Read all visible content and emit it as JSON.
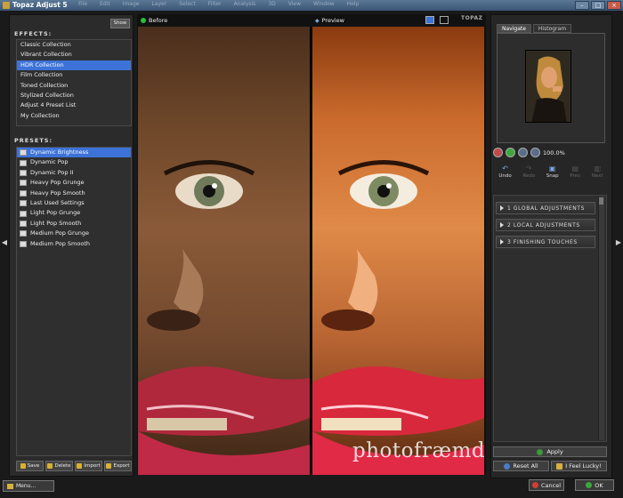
{
  "window": {
    "title": "Topaz Adjust 5",
    "menus": [
      "File",
      "Edit",
      "Image",
      "Layer",
      "Select",
      "Filter",
      "Analysis",
      "3D",
      "View",
      "Window",
      "Help"
    ]
  },
  "left": {
    "show_label": "Show",
    "effects_title": "EFFECTS:",
    "effects": [
      {
        "label": "Classic Collection",
        "selected": false
      },
      {
        "label": "Vibrant Collection",
        "selected": false
      },
      {
        "label": "HDR Collection",
        "selected": true
      },
      {
        "label": "Film Collection",
        "selected": false
      },
      {
        "label": "Toned Collection",
        "selected": false
      },
      {
        "label": "Stylized Collection",
        "selected": false
      },
      {
        "label": "Adjust 4 Preset List",
        "selected": false
      },
      {
        "label": "My Collection",
        "selected": false
      }
    ],
    "presets_title": "PRESETS:",
    "presets": [
      {
        "label": "Dynamic Brightness",
        "selected": true
      },
      {
        "label": "Dynamic Pop",
        "selected": false
      },
      {
        "label": "Dynamic Pop II",
        "selected": false
      },
      {
        "label": "Heavy Pop Grunge",
        "selected": false
      },
      {
        "label": "Heavy Pop Smooth",
        "selected": false
      },
      {
        "label": "Last Used Settings",
        "selected": false
      },
      {
        "label": "Light Pop Grunge",
        "selected": false
      },
      {
        "label": "Light Pop Smooth",
        "selected": false
      },
      {
        "label": "Medium Pop Grunge",
        "selected": false
      },
      {
        "label": "Medium Pop Smooth",
        "selected": false
      }
    ],
    "buttons": {
      "save": "Save",
      "delete": "Delete",
      "import": "Import",
      "export": "Export"
    },
    "menu_label": "Menu..."
  },
  "viewer": {
    "before_label": "Before",
    "preview_label": "Preview",
    "logo": "TOPAZ",
    "watermark": "photofræmd"
  },
  "right": {
    "tabs": [
      {
        "label": "Navigate",
        "active": true
      },
      {
        "label": "Histogram",
        "active": false
      }
    ],
    "zoom": "100.0%",
    "history": [
      {
        "label": "Undo",
        "icon": "undo-icon",
        "enabled": true
      },
      {
        "label": "Redo",
        "icon": "redo-icon",
        "enabled": false
      },
      {
        "label": "Snap",
        "icon": "snap-icon",
        "enabled": true
      },
      {
        "label": "Prev",
        "icon": "prev-icon",
        "enabled": false
      },
      {
        "label": "Next",
        "icon": "next-icon",
        "enabled": false
      }
    ],
    "adjustments": [
      {
        "label": "1 GLOBAL ADJUSTMENTS"
      },
      {
        "label": "2 LOCAL ADJUSTMENTS"
      },
      {
        "label": "3 FINISHING TOUCHES"
      }
    ],
    "apply_label": "Apply",
    "reset_label": "Reset All",
    "lucky_label": "I Feel Lucky!",
    "cancel_label": "Cancel",
    "ok_label": "OK"
  },
  "colors": {
    "selection": "#3d72d8",
    "panel": "#2b2b2b",
    "before_dot": "#2bbf3a",
    "preview_dot": "#3d72d8"
  }
}
